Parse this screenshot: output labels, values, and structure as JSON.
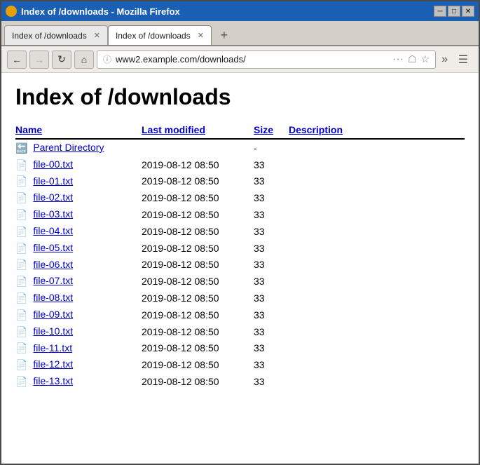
{
  "window": {
    "title": "Index of /downloads - Mozilla Firefox"
  },
  "tabs": [
    {
      "label": "Index of /downloads",
      "active": false
    },
    {
      "label": "Index of /downloads",
      "active": true
    }
  ],
  "nav": {
    "url": "www2.example.com/downloads/",
    "back_disabled": false,
    "forward_disabled": true
  },
  "page": {
    "title": "Index of /downloads",
    "columns": {
      "name": "Name",
      "modified": "Last modified",
      "size": "Size",
      "description": "Description"
    },
    "parent_dir": {
      "label": "Parent Directory",
      "size": "-"
    },
    "files": [
      {
        "name": "file-00.txt",
        "modified": "2019-08-12 08:50",
        "size": "33"
      },
      {
        "name": "file-01.txt",
        "modified": "2019-08-12 08:50",
        "size": "33"
      },
      {
        "name": "file-02.txt",
        "modified": "2019-08-12 08:50",
        "size": "33"
      },
      {
        "name": "file-03.txt",
        "modified": "2019-08-12 08:50",
        "size": "33"
      },
      {
        "name": "file-04.txt",
        "modified": "2019-08-12 08:50",
        "size": "33"
      },
      {
        "name": "file-05.txt",
        "modified": "2019-08-12 08:50",
        "size": "33"
      },
      {
        "name": "file-06.txt",
        "modified": "2019-08-12 08:50",
        "size": "33"
      },
      {
        "name": "file-07.txt",
        "modified": "2019-08-12 08:50",
        "size": "33"
      },
      {
        "name": "file-08.txt",
        "modified": "2019-08-12 08:50",
        "size": "33"
      },
      {
        "name": "file-09.txt",
        "modified": "2019-08-12 08:50",
        "size": "33"
      },
      {
        "name": "file-10.txt",
        "modified": "2019-08-12 08:50",
        "size": "33"
      },
      {
        "name": "file-11.txt",
        "modified": "2019-08-12 08:50",
        "size": "33"
      },
      {
        "name": "file-12.txt",
        "modified": "2019-08-12 08:50",
        "size": "33"
      },
      {
        "name": "file-13.txt",
        "modified": "2019-08-12 08:50",
        "size": "33"
      }
    ]
  }
}
